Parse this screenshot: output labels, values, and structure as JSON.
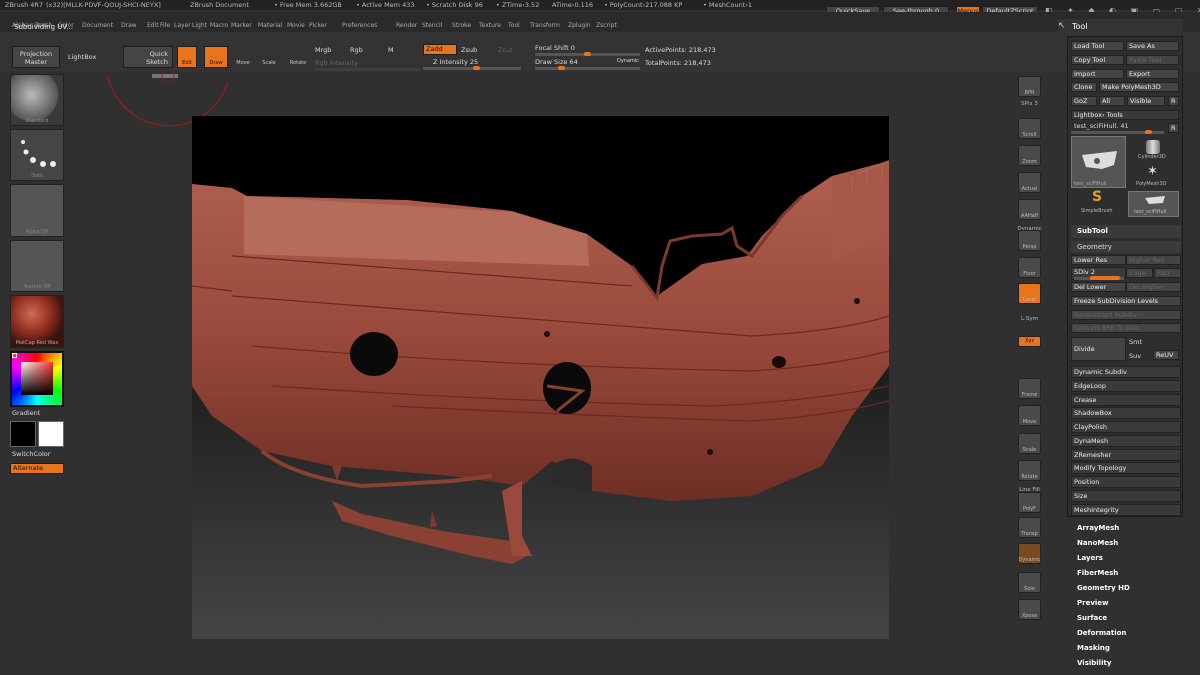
{
  "titlebar": {
    "app": "ZBrush 4R7",
    "build": "(x32)[MLLK-PDVF-QOUJ-SHCI-NEYX]",
    "doc": "ZBrush Document",
    "free_mem": "• Free Mem 3.662GB",
    "active_mem": "• Active Mem 433",
    "scratch": "• Scratch Disk 96",
    "ztime": "• ZTime›3.52",
    "atime": "ATime›0.116",
    "polycount": "• PolyCount›217.088 KP",
    "meshcount": "• MeshCount›1"
  },
  "topright": {
    "quicksave": "QuickSave",
    "seethrough": "See-through  0",
    "menus": "Menus",
    "script": "DefaultZScript"
  },
  "menus": [
    "Alpha",
    "Brush",
    "Color",
    "Document",
    "Draw",
    "Edit",
    "File",
    "Layer",
    "Light",
    "Macro",
    "Marker",
    "Material",
    "Movie",
    "Picker",
    "Preferences",
    "Render",
    "Stencil",
    "Stroke",
    "Texture",
    "Tool",
    "Transform",
    "Zplugin",
    "Zscript"
  ],
  "status": "Subdividing UV...",
  "toolbar": {
    "projection": "Projection\nMaster",
    "lightbox": "LightBox",
    "quicksketch": "Quick\nSketch",
    "edit": "Edit",
    "draw": "Draw",
    "move": "Move",
    "scale": "Scale",
    "rotate": "Rotate",
    "mrgb": "Mrgb",
    "rgb": "Rgb",
    "m": "M",
    "rgb_intensity": "Rgb Intensity",
    "zadd": "Zadd",
    "zsub": "Zsub",
    "zcut": "Zcut",
    "z_intensity": "Z Intensity 25",
    "focal_shift": "Focal Shift 0",
    "draw_size": "Draw Size 64",
    "dynamic": "Dynamic",
    "active_points": "ActivePoints: 218,473",
    "total_points": "TotalPoints: 218,473"
  },
  "leftshelf": {
    "brush": "Standard",
    "stroke": "Dots",
    "alpha": "Alpha Off",
    "texture": "Texture Off",
    "material": "MatCap Red Wax",
    "gradient": "Gradient",
    "switchcolor": "SwitchColor",
    "alternate": "Alternate"
  },
  "rightshelf": [
    "BPR",
    "SPix 3",
    "Scroll",
    "Zoom",
    "Actual",
    "AAHalf",
    "Dynamic",
    "Persp",
    "Floor",
    "Local",
    "L.Sym",
    "Xyz",
    "Frame",
    "Move",
    "Scale",
    "Rotate",
    "Line Fill",
    "PolyF",
    "Transp",
    "Dynamic",
    "Solo",
    "Xpose"
  ],
  "toolpanel": {
    "title": "Tool",
    "load": "Load Tool",
    "saveas": "Save As",
    "copy": "Copy Tool",
    "paste": "Paste Tool",
    "import": "Import",
    "export": "Export",
    "clone": "Clone",
    "makepoly": "Make PolyMesh3D",
    "goz": "GoZ",
    "all": "All",
    "visible": "Visible",
    "r": "R",
    "lightbox_tools": "Lightbox› Tools",
    "current_tool": "test_sciFiHull. 41",
    "r2": "R",
    "tools": [
      "test_sciFiHull",
      "Cylinder3D",
      "PolyMesh3D",
      "SimpleBrush",
      "test_sciFiHull"
    ],
    "subtool": "SubTool",
    "geometry": "Geometry",
    "lower_res": "Lower Res",
    "higher_res": "Higher Res",
    "sdiv": "SDiv 2",
    "cage": "Cage",
    "rstr": "Rstr",
    "del_lower": "Del Lower",
    "del_higher": "Del Higher",
    "freeze": "Freeze SubDivision Levels",
    "reconstruct": "Reconstruct Subdiv",
    "convert": "Convert BPR To Geo",
    "divide": "Divide",
    "smt": "Smt",
    "suv": "Suv",
    "reuv": "ReUV",
    "items": [
      "Dynamic Subdiv",
      "EdgeLoop",
      "Crease",
      "ShadowBox",
      "ClayPolish",
      "DynaMesh",
      "ZRemesher",
      "Modify Topology",
      "Position",
      "Size",
      "MeshIntegrity"
    ]
  },
  "sections": [
    "ArrayMesh",
    "NanoMesh",
    "Layers",
    "FiberMesh",
    "Geometry HD",
    "Preview",
    "Surface",
    "Deformation",
    "Masking",
    "Visibility"
  ],
  "colors": {
    "accent": "#e8741c",
    "hull": "#9a4a3c"
  }
}
